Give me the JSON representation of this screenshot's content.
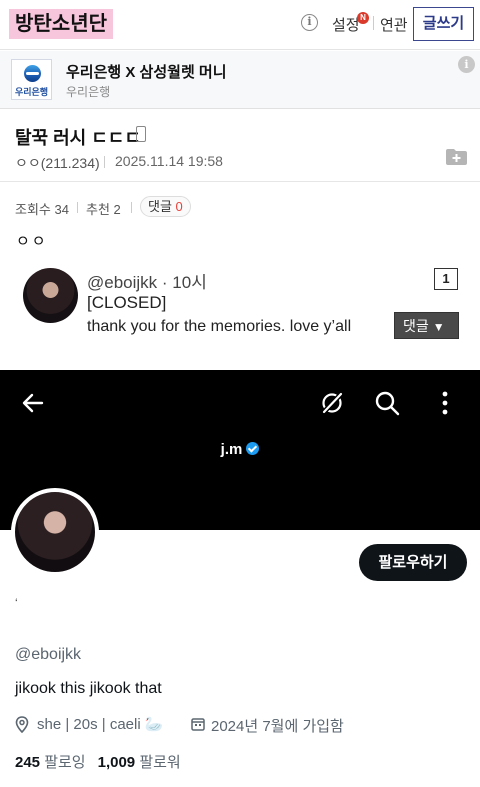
{
  "header": {
    "gallery_title": "방탄소년단",
    "settings_label": "설정",
    "settings_badge": "N",
    "related_label": "연관",
    "write_label": "글쓰기"
  },
  "ad": {
    "logo_text": "우리은행",
    "title": "우리은행 X 삼성월렛 머니",
    "subtitle": "우리은행"
  },
  "post": {
    "title": "탈꾹 러시 ㄷㄷㄷ",
    "author": "ㅇㅇ(211.234)",
    "date": "2025.11.14 19:58",
    "views_label": "조회수 34",
    "recommend_label": "추천 2",
    "comments_label": "댓글",
    "comments_count": "0",
    "body": "ㅇㅇ"
  },
  "tweet": {
    "handle": "@eboijkk · 10시",
    "line1": "[CLOSED]",
    "line2": "thank you for the memories. love y’all",
    "page_number": "1",
    "comment_dropdown": "댓글"
  },
  "profile": {
    "display_name": "j.m",
    "follow_label": "팔로우하기",
    "stray_mark": "‘",
    "handle": "@eboijkk",
    "bio": "jikook this jikook that",
    "location": "she | 20s | caeli 🦢",
    "joined": "2024년 7월에 가입함",
    "following_count": "245",
    "following_label": "팔로잉",
    "followers_count": "1,009",
    "followers_label": "팔로워"
  },
  "colors": {
    "title_highlight": "#f7c5dc",
    "write_button_border": "#3b4890",
    "verified_blue": "#1d9bf0",
    "comment_count_red": "#e8423b"
  }
}
